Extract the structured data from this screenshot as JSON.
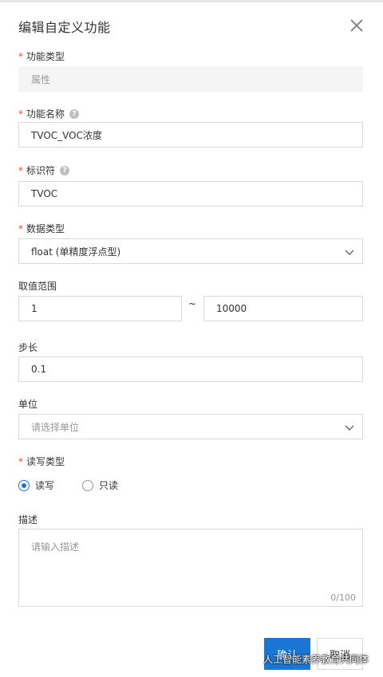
{
  "dialog": {
    "title": "编辑自定义功能",
    "close_icon": "close-icon"
  },
  "form": {
    "func_type": {
      "required": "*",
      "label": "功能类型",
      "value": "属性"
    },
    "func_name": {
      "required": "*",
      "label": "功能名称",
      "value": "TVOC_VOC浓度",
      "help": "?"
    },
    "identifier": {
      "required": "*",
      "label": "标识符",
      "value": "TVOC",
      "help": "?"
    },
    "data_type": {
      "required": "*",
      "label": "数据类型",
      "value": "float (单精度浮点型)"
    },
    "range": {
      "label": "取值范围",
      "min": "1",
      "separator": "~",
      "max": "10000"
    },
    "step": {
      "label": "步长",
      "value": "0.1"
    },
    "unit": {
      "label": "单位",
      "placeholder": "请选择单位"
    },
    "rw_type": {
      "required": "*",
      "label": "读写类型",
      "options": [
        {
          "label": "读写",
          "checked": true
        },
        {
          "label": "只读",
          "checked": false
        }
      ]
    },
    "description": {
      "label": "描述",
      "placeholder": "请输入描述",
      "counter": "0/100"
    }
  },
  "footer": {
    "confirm_label": "确认",
    "cancel_label": "取消"
  },
  "watermark": {
    "text": "人工智能素养教育共同体"
  },
  "colors": {
    "primary": "#1976d2",
    "required": "#e74c3c",
    "border": "#d9d9d9"
  }
}
